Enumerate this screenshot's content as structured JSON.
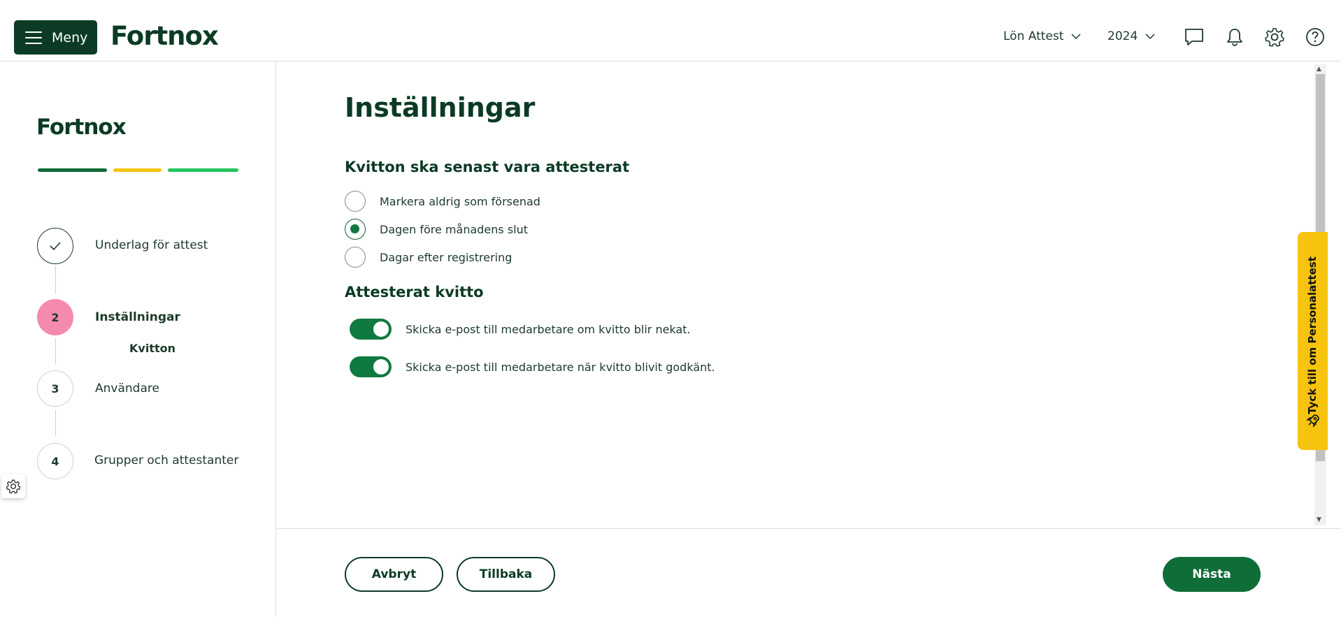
{
  "header": {
    "menu_label": "Meny",
    "logo_text": "Fortnox",
    "company_dropdown": "Lön Attest",
    "year_dropdown": "2024"
  },
  "sidebar": {
    "logo_text": "Fortnox",
    "progress_colors": [
      "#0f6d38",
      "#f6c30f",
      "#22c55e"
    ],
    "steps": [
      {
        "marker": "",
        "label": "Underlag för attest",
        "state": "done"
      },
      {
        "marker": "2",
        "label": "Inställningar",
        "state": "active",
        "sub_label": "Kvitton"
      },
      {
        "marker": "3",
        "label": "Användare",
        "state": "todo"
      },
      {
        "marker": "4",
        "label": "Grupper och attestanter",
        "state": "todo"
      }
    ]
  },
  "main": {
    "title": "Inställningar",
    "section1_title": "Kvitton ska senast vara attesterat",
    "radios": [
      {
        "label": "Markera aldrig som försenad",
        "checked": false
      },
      {
        "label": "Dagen före månadens slut",
        "checked": true
      },
      {
        "label": "Dagar efter registrering",
        "checked": false
      }
    ],
    "section2_title": "Attesterat kvitto",
    "toggles": [
      {
        "label": "Skicka e-post till medarbetare om kvitto blir nekat.",
        "on": true
      },
      {
        "label": "Skicka e-post till medarbetare när kvitto blivit godkänt.",
        "on": true
      }
    ]
  },
  "feedback_tab": {
    "label": "Tyck till om Personalattest"
  },
  "footer": {
    "cancel_label": "Avbryt",
    "back_label": "Tillbaka",
    "next_label": "Nästa"
  },
  "colors": {
    "brand_dark": "#0b3b24",
    "brand_green": "#0f6d38",
    "accent_yellow": "#f6c30f",
    "active_step_pink": "#f58ab0"
  }
}
